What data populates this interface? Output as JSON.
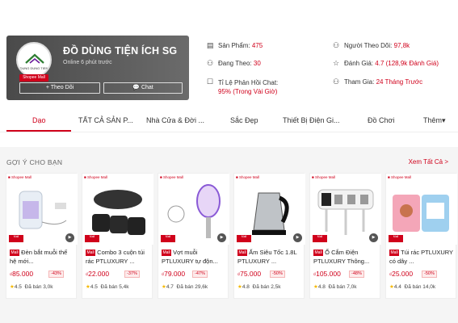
{
  "shop": {
    "name": "ĐỒ DÙNG TIỆN ÍCH SG",
    "online": "Online 6 phút trước",
    "mall_badge": "Shopee Mall",
    "avatar_text": "DUNG DUNG TIEN",
    "follow_label": "+ Theo Dõi",
    "chat_label": "Chat"
  },
  "stats": {
    "products_label": "Sản Phẩm:",
    "products_value": "475",
    "following_label": "Đang Theo:",
    "following_value": "30",
    "response_label": "Tỉ Lệ Phản Hồi Chat:",
    "response_value": "95% (Trong Vài Giờ)",
    "followers_label": "Người Theo Dõi:",
    "followers_value": "97,8k",
    "rating_label": "Đánh Giá:",
    "rating_value": "4.7 (128,9k Đánh Giá)",
    "joined_label": "Tham Gia:",
    "joined_value": "24 Tháng Trước"
  },
  "tabs": [
    "Dạo",
    "TẤT CẢ SẢN P...",
    "Nhà Cửa & Đời ...",
    "Sắc Đẹp",
    "Thiết Bị Điện Gi...",
    "Đồ Chơi",
    "Thêm"
  ],
  "section": {
    "title": "GỢI Ý CHO BẠN",
    "see_all": "Xem Tất Cả >"
  },
  "products": [
    {
      "mall_tag": "Shopee Mall",
      "promo": "Mall",
      "name": "Đèn bắt muỗi thế hệ mới...",
      "price": "85.000",
      "discount": "-43%",
      "rating": "4.5",
      "sold": "Đã bán 3,0k"
    },
    {
      "mall_tag": "Shopee Mall",
      "promo": "Mall",
      "name": "Combo 3 cuộn túi rác PTLUXURY ...",
      "price": "22.000",
      "discount": "-37%",
      "rating": "4.5",
      "sold": "Đã bán 5,4k"
    },
    {
      "mall_tag": "Shopee Mall",
      "promo": "Mall",
      "name": "Vợt muỗi PTLUXURY tự độn...",
      "price": "79.000",
      "discount": "-47%",
      "rating": "4.7",
      "sold": "Đã bán 29,6k"
    },
    {
      "mall_tag": "Shopee Mall",
      "promo": "Mall",
      "name": "Ấm Siêu Tốc 1.8L PTLUXURY ...",
      "price": "75.000",
      "discount": "-50%",
      "rating": "4.8",
      "sold": "Đã bán 2,5k"
    },
    {
      "mall_tag": "Shopee Mall",
      "promo": "Mall",
      "name": "Ổ Cắm Điện PTLUXURY Thông...",
      "price": "105.000",
      "discount": "-48%",
      "rating": "4.8",
      "sold": "Đã bán 7,0k"
    },
    {
      "mall_tag": "Shopee Mall",
      "promo": "Mall",
      "name": "Túi rác PTLUXURY có dây ...",
      "price": "25.000",
      "discount": "-50%",
      "rating": "4.4",
      "sold": "Đã bán 14,0k"
    }
  ],
  "currency": "₫",
  "colors": {
    "accent": "#d0011b",
    "star": "#f5b800"
  }
}
